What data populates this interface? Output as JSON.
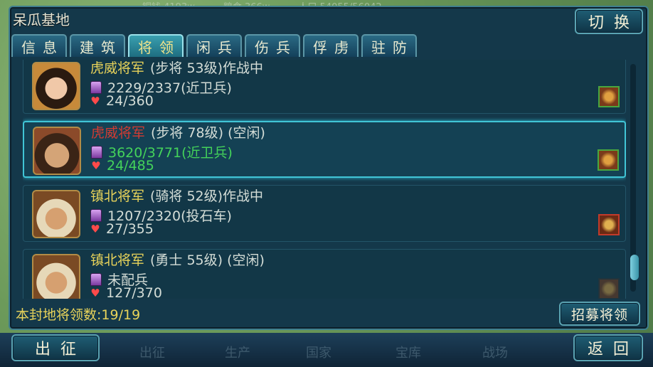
{
  "window": {
    "title": "呆瓜基地"
  },
  "resources": {
    "copper": "铜钱 4193w",
    "food": "粮食 366w",
    "population": "人口 54055/56042"
  },
  "buttons": {
    "switch": "切换",
    "recruit": "招募将领",
    "go": "出征",
    "back": "返回"
  },
  "tabs": [
    {
      "label": "信息",
      "active": false
    },
    {
      "label": "建筑",
      "active": false
    },
    {
      "label": "将领",
      "active": true
    },
    {
      "label": "闲兵",
      "active": false
    },
    {
      "label": "伤兵",
      "active": false
    },
    {
      "label": "俘虏",
      "active": false
    },
    {
      "label": "驻防",
      "active": false
    }
  ],
  "generals": [
    {
      "rank": "虎威将军",
      "desc": "(步将 53级)作战中",
      "troops": "2229/2337(近卫兵)",
      "hp": "24/360",
      "selected": false,
      "avatar": "female-general-portrait",
      "unit_icon": "guard-unit-icon"
    },
    {
      "rank": "虎威将军",
      "desc": "(步将 78级) (空闲)",
      "troops": "3620/3771(近卫兵)",
      "hp": "24/485",
      "selected": true,
      "avatar": "male-general-portrait",
      "unit_icon": "guard-unit-icon"
    },
    {
      "rank": "镇北将军",
      "desc": "(骑将 52级)作战中",
      "troops": "1207/2320(投石车)",
      "hp": "27/355",
      "selected": false,
      "avatar": "helmeted-general-portrait",
      "unit_icon": "catapult-unit-icon"
    },
    {
      "rank": "镇北将军",
      "desc": "(勇士 55级) (空闲)",
      "troops": "未配兵",
      "hp": "127/370",
      "selected": false,
      "avatar": "helmeted-general-portrait",
      "unit_icon": "empty-unit-icon"
    }
  ],
  "footer": {
    "count_text": "本封地将领数:19/19"
  },
  "bottom_nav": [
    "出征",
    "生产",
    "国家",
    "宝库",
    "战场"
  ],
  "colors": {
    "rank_gold": "#e8d35a",
    "rank_red": "#d33b32",
    "active_green": "#44d35a",
    "panel": "#14384a"
  }
}
